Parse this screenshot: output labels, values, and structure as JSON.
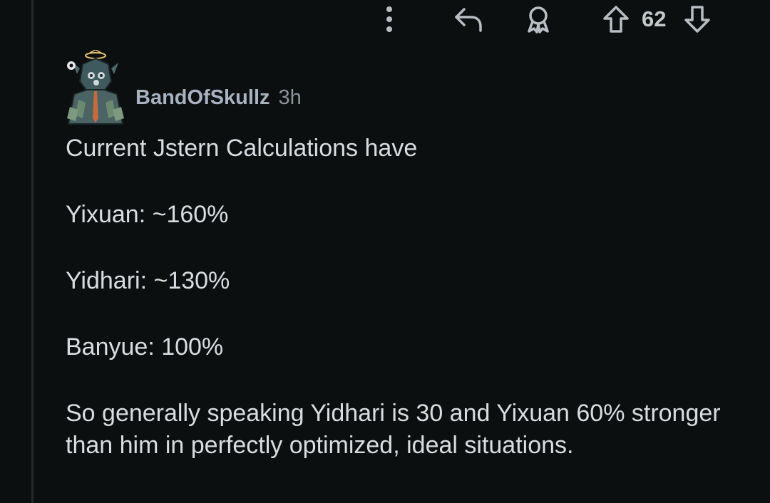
{
  "actions": {
    "more_icon": "more-vertical-icon",
    "reply_icon": "reply-icon",
    "award_icon": "award-icon",
    "upvote_icon": "upvote-arrow-icon",
    "vote_count": "62",
    "downvote_icon": "downvote-arrow-icon"
  },
  "comment": {
    "username": "BandOfSkullz",
    "time": "3h",
    "paragraphs": [
      "Current Jstern Calculations have",
      "Yixuan: ~160%",
      "Yidhari: ~130%",
      "Banyue: 100%",
      "So generally speaking Yidhari is 30 and Yixuan 60% stronger than him in perfectly optimized, ideal situations."
    ]
  },
  "colors": {
    "background": "#0b0f10",
    "text": "#d9dde1",
    "username": "#a7b3c0",
    "icon": "#b8bec4",
    "thread_line": "#24282b"
  }
}
